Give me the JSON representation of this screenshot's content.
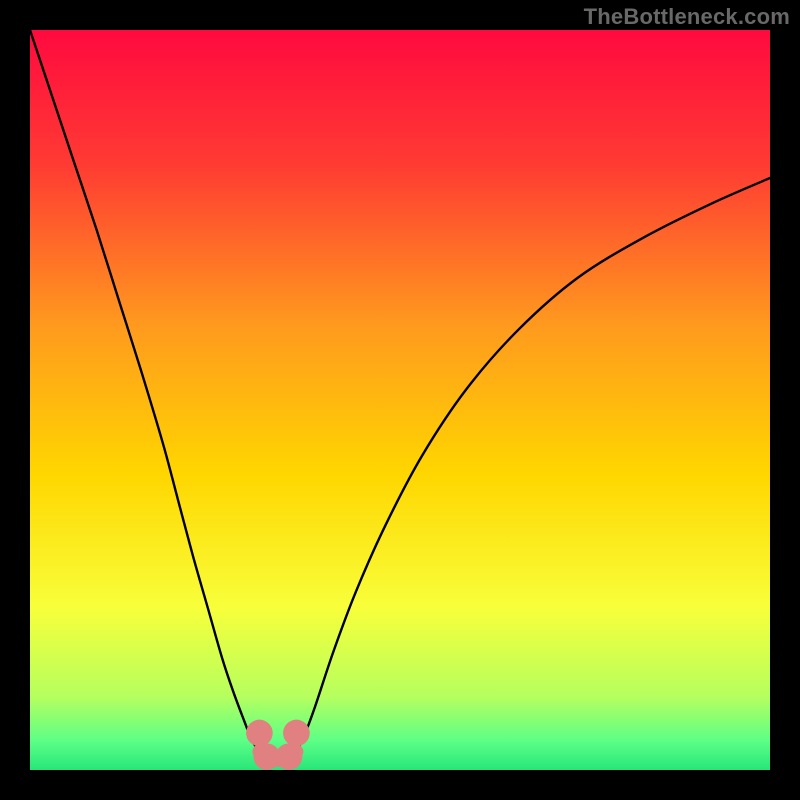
{
  "attribution": "TheBottleneck.com",
  "chart_data": {
    "type": "line",
    "title": "",
    "xlabel": "",
    "ylabel": "",
    "xlim": [
      0,
      100
    ],
    "ylim": [
      0,
      100
    ],
    "gradient_stops": [
      {
        "offset": 0.0,
        "color": "#ff0a3f"
      },
      {
        "offset": 0.18,
        "color": "#ff3a33"
      },
      {
        "offset": 0.4,
        "color": "#ff9a1e"
      },
      {
        "offset": 0.6,
        "color": "#ffd600"
      },
      {
        "offset": 0.78,
        "color": "#f8ff3a"
      },
      {
        "offset": 0.9,
        "color": "#b6ff5e"
      },
      {
        "offset": 0.96,
        "color": "#5dff86"
      },
      {
        "offset": 1.0,
        "color": "#28e67a"
      }
    ],
    "series": [
      {
        "name": "left-arc",
        "x": [
          0.0,
          3.0,
          6.0,
          9.0,
          12.0,
          15.0,
          18.0,
          20.0,
          22.0,
          24.0,
          26.0,
          27.5,
          29.0,
          30.0,
          31.0
        ],
        "values": [
          100.0,
          91.0,
          82.0,
          73.0,
          63.5,
          54.0,
          44.0,
          36.5,
          29.0,
          22.0,
          15.0,
          10.5,
          6.5,
          4.0,
          2.5
        ]
      },
      {
        "name": "right-arc",
        "x": [
          36.0,
          37.0,
          38.5,
          41.0,
          44.0,
          48.0,
          53.0,
          59.0,
          66.0,
          74.0,
          83.0,
          92.0,
          100.0
        ],
        "values": [
          2.5,
          4.5,
          8.5,
          16.0,
          24.0,
          33.0,
          42.5,
          51.5,
          59.5,
          66.5,
          72.0,
          76.5,
          80.0
        ]
      },
      {
        "name": "flat-bridge",
        "x": [
          31.0,
          32.0,
          33.0,
          34.0,
          35.0,
          36.0
        ],
        "values": [
          2.5,
          1.7,
          1.4,
          1.4,
          1.7,
          2.5
        ]
      }
    ],
    "markers": [
      {
        "name": "endpoint-left-top",
        "x": 31.0,
        "y": 5.0,
        "r": 1.8
      },
      {
        "name": "endpoint-left-bottom",
        "x": 32.0,
        "y": 1.8,
        "r": 1.8
      },
      {
        "name": "endpoint-right-bottom",
        "x": 35.0,
        "y": 1.8,
        "r": 1.8
      },
      {
        "name": "endpoint-right-top",
        "x": 36.0,
        "y": 5.0,
        "r": 1.8
      }
    ],
    "marker_color": "#e08080",
    "curve_color": "#000000"
  }
}
